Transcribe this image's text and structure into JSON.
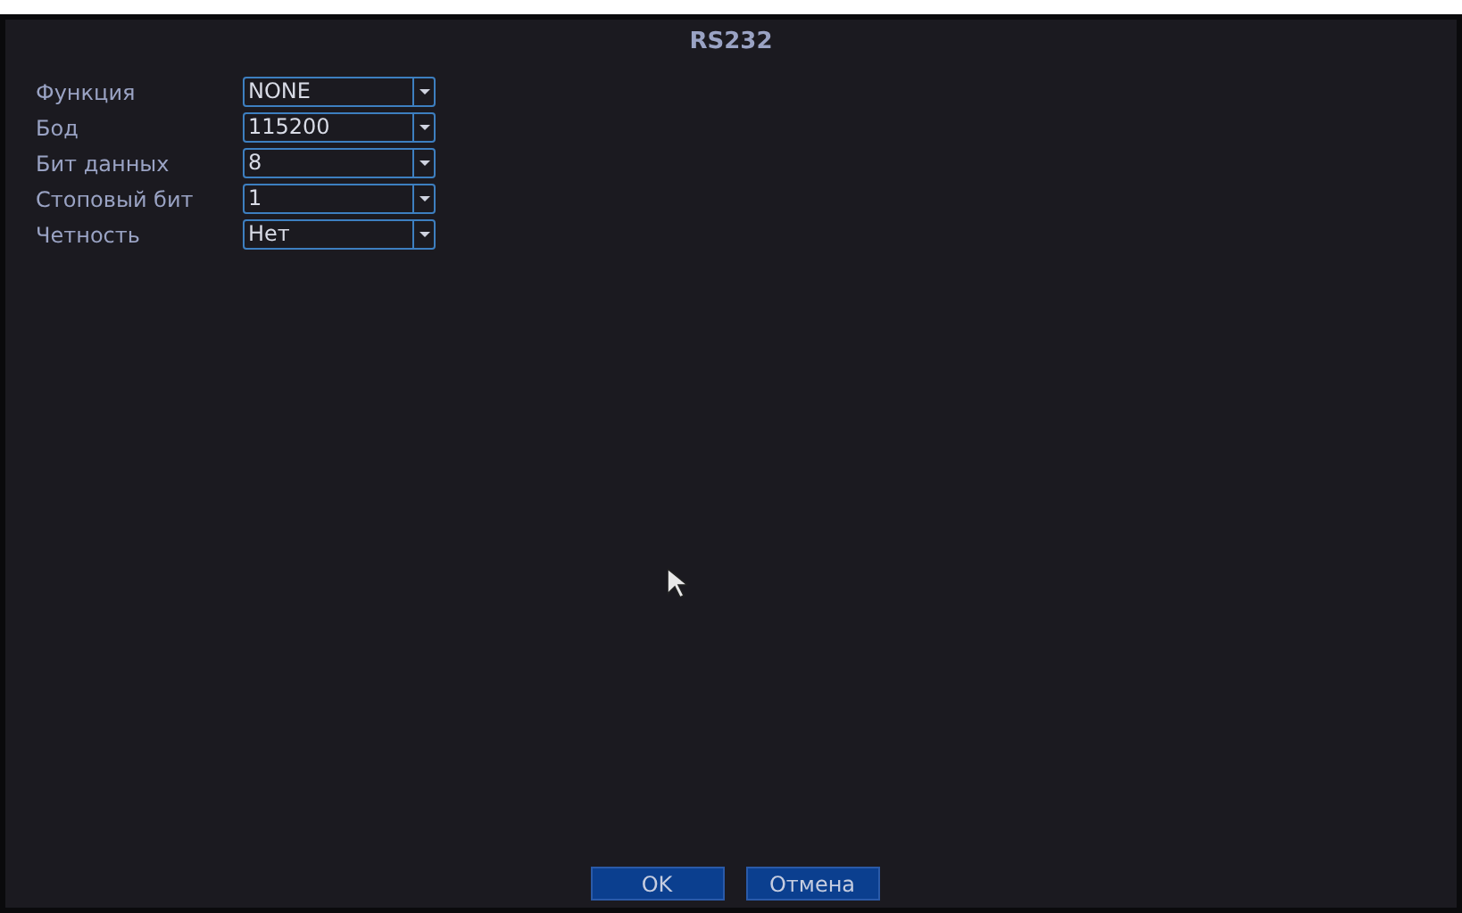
{
  "window": {
    "title": "RS232"
  },
  "fields": [
    {
      "label": "Функция",
      "value": "NONE"
    },
    {
      "label": "Бод",
      "value": "115200"
    },
    {
      "label": "Бит данных",
      "value": "8"
    },
    {
      "label": "Стоповый бит",
      "value": "1"
    },
    {
      "label": "Четность",
      "value": "Нет"
    }
  ],
  "buttons": [
    "OK",
    "Отмена"
  ]
}
